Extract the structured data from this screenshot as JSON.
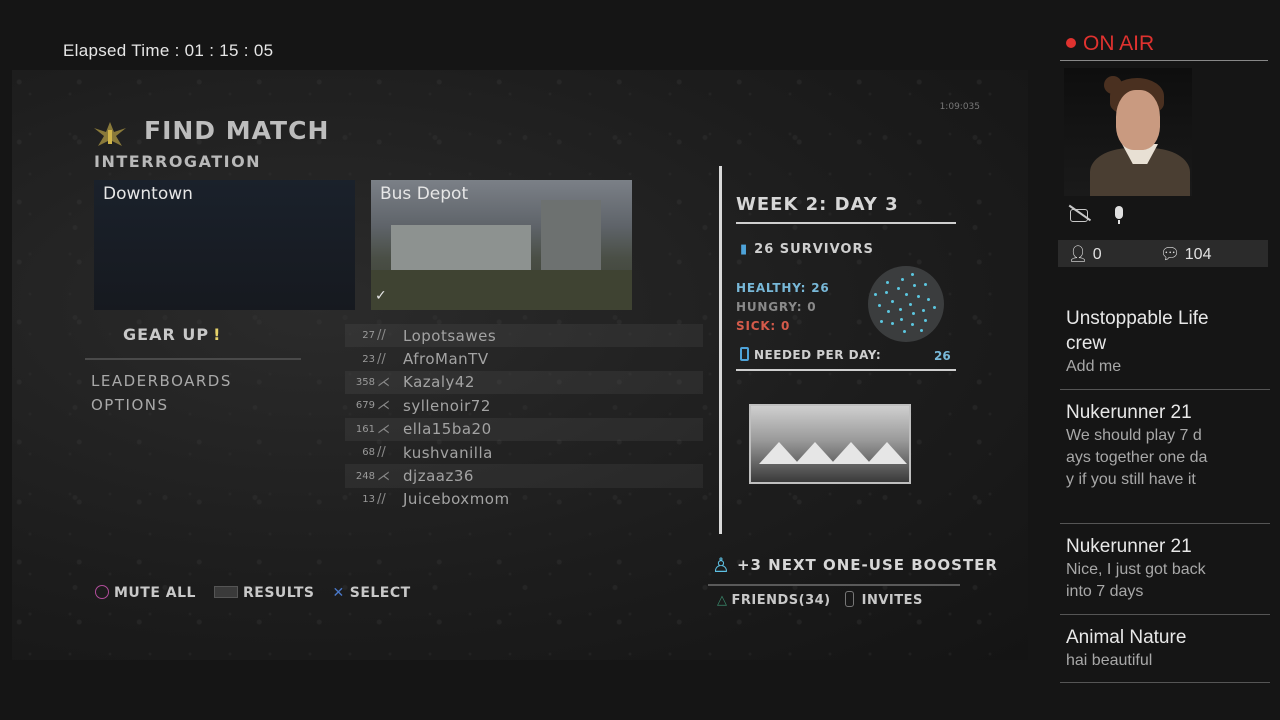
{
  "stream": {
    "elapsed": "Elapsed Time : 01 : 15 : 05",
    "on_air": "ON AIR",
    "viewers": "0",
    "comments": "104"
  },
  "game": {
    "timecode": "1:09:035",
    "title": "FIND MATCH",
    "mode": "INTERROGATION",
    "maps": [
      {
        "name": "Downtown"
      },
      {
        "name": "Bus Depot",
        "check": "✓"
      }
    ],
    "gear_up": "GEAR UP",
    "menu": [
      "LEADERBOARDS",
      "OPTIONS"
    ],
    "players": [
      {
        "rank": "27",
        "name": "Lopotsawes"
      },
      {
        "rank": "23",
        "name": "AfroManTV"
      },
      {
        "rank": "358",
        "name": "Kazaly42"
      },
      {
        "rank": "679",
        "name": "syllenoir72"
      },
      {
        "rank": "161",
        "name": "ella15ba20"
      },
      {
        "rank": "68",
        "name": "kushvanilla"
      },
      {
        "rank": "248",
        "name": "djzaaz36"
      },
      {
        "rank": "13",
        "name": "Juiceboxmom"
      }
    ],
    "week": "WEEK 2: DAY 3",
    "survivors": "26 SURVIVORS",
    "healthy": "HEALTHY: 26",
    "hungry": "HUNGRY: 0",
    "sick": "SICK: 0",
    "needed_label": "NEEDED PER DAY:",
    "needed_value": "26",
    "booster": "+3 NEXT ONE-USE BOOSTER",
    "friends": "FRIENDS(34)",
    "invites": "INVITES",
    "bottom": {
      "mute_all": "MUTE ALL",
      "results": "RESULTS",
      "select": "SELECT"
    }
  },
  "chat": [
    {
      "name": "Unstoppable Life crew",
      "msg": "Add me"
    },
    {
      "name": "Nukerunner 21",
      "msg": "We should play 7 days together one day if you still have it"
    },
    {
      "name": "Nukerunner 21",
      "msg": "Nice, I just got back into 7 days"
    },
    {
      "name": "Animal Nature",
      "msg": "hai beautiful"
    }
  ],
  "colors": {
    "on_air": "#e0322f",
    "healthy": "#78b8d8",
    "sick": "#d45a4a",
    "accent_blue": "#4ea3d9"
  }
}
